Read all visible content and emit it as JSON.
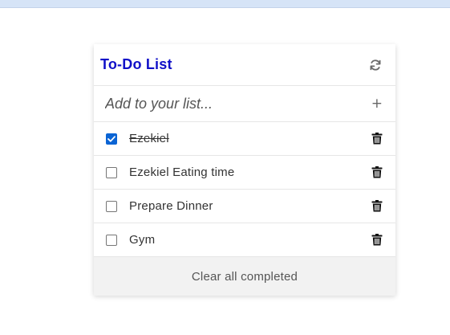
{
  "app": {
    "title": "To-Do List",
    "refresh_icon": "refresh-icon",
    "title_color": "#1010c8"
  },
  "add": {
    "placeholder": "Add to your list...",
    "value": "",
    "add_icon": "+"
  },
  "tasks": [
    {
      "text": "Ezekiel",
      "completed": true
    },
    {
      "text": "Ezekiel Eating time",
      "completed": false
    },
    {
      "text": "Prepare Dinner",
      "completed": false
    },
    {
      "text": "Gym",
      "completed": false
    }
  ],
  "footer": {
    "clear_label": "Clear all completed"
  },
  "colors": {
    "accent": "#0b64d4",
    "footer_bg": "#f2f2f2"
  }
}
